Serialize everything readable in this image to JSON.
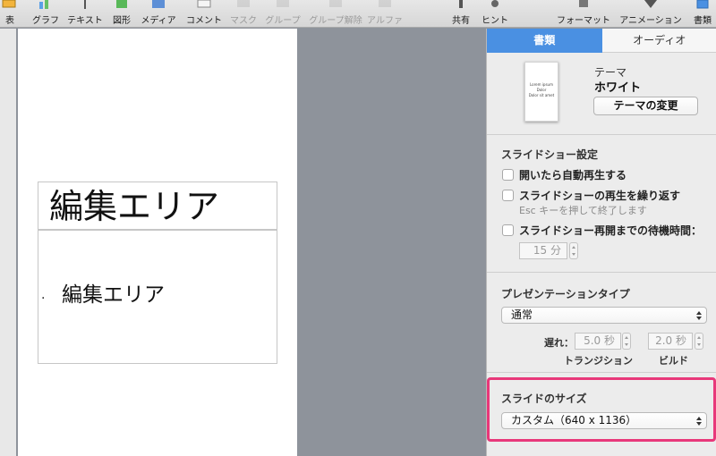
{
  "toolbar": {
    "items": [
      {
        "label": "表",
        "icon": "table-icon",
        "enabled": true
      },
      {
        "label": "グラフ",
        "icon": "chart-icon",
        "enabled": true
      },
      {
        "label": "テキスト",
        "icon": "text-icon",
        "enabled": true
      },
      {
        "label": "図形",
        "icon": "shape-icon",
        "enabled": true
      },
      {
        "label": "メディア",
        "icon": "media-icon",
        "enabled": true
      },
      {
        "label": "コメント",
        "icon": "comment-icon",
        "enabled": true
      },
      {
        "label": "マスク",
        "icon": "mask-icon",
        "enabled": false
      },
      {
        "label": "グループ",
        "icon": "group-icon",
        "enabled": false
      },
      {
        "label": "グループ解除",
        "icon": "ungroup-icon",
        "enabled": false
      },
      {
        "label": "アルファ",
        "icon": "alpha-icon",
        "enabled": false
      },
      {
        "label": "共有",
        "icon": "share-icon",
        "enabled": true
      },
      {
        "label": "ヒント",
        "icon": "tips-icon",
        "enabled": true
      },
      {
        "label": "フォーマット",
        "icon": "format-icon",
        "enabled": true
      },
      {
        "label": "アニメーション",
        "icon": "animation-icon",
        "enabled": true
      },
      {
        "label": "書類",
        "icon": "document-icon",
        "enabled": true
      }
    ]
  },
  "slide": {
    "title": "編集エリア",
    "body_bullet": "·",
    "body_text": "編集エリア"
  },
  "panel": {
    "tabs": [
      {
        "label": "書類",
        "active": true
      },
      {
        "label": "オーディオ",
        "active": false
      }
    ],
    "theme": {
      "thumbnail_lines": [
        "Lorem ipsum",
        "Dolor",
        "Dolor sit amet"
      ],
      "caption": "テーマ",
      "name": "ホワイト",
      "change_button": "テーマの変更"
    },
    "slideshow": {
      "title": "スライドショー設定",
      "autoplay_label": "開いたら自動再生する",
      "loop_label": "スライドショーの再生を繰り返す",
      "loop_hint": "Esc キーを押して終了します",
      "idle_label": "スライドショー再開までの待機時間：",
      "idle_value": "15 分"
    },
    "presentation": {
      "title": "プレゼンテーションタイプ",
      "type_value": "通常",
      "delay_label": "遅れ：",
      "transition_value": "5.0 秒",
      "build_value": "2.0 秒",
      "transition_label": "トランジション",
      "build_label": "ビルド"
    },
    "slide_size": {
      "title": "スライドのサイズ",
      "value": "カスタム（640 x 1136）"
    }
  },
  "colors": {
    "active_tab": "#4a90e2",
    "highlight": "#e8387a",
    "canvas": "#8e939b"
  }
}
